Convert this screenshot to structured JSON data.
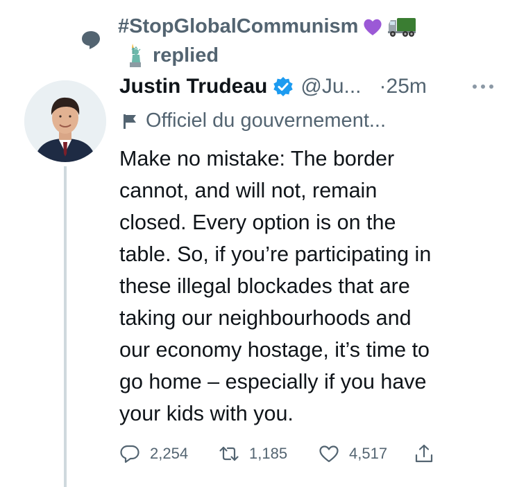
{
  "context": {
    "user_display": "#StopGlobalCommunism",
    "action_text": "replied",
    "icons": [
      "reply-bubble-icon",
      "purple-heart-emoji",
      "truck-emoji",
      "statue-of-liberty-emoji"
    ]
  },
  "tweet": {
    "author_name": "Justin Trudeau",
    "verified": true,
    "handle": "@Ju...",
    "separator": "·",
    "time": "25m",
    "account_label": "Officiel du gouvernement...",
    "text": "Make no mistake: The border\ncannot, and will not, remain\nclosed. Every option is on the\ntable. So, if you’re participating in\nthese illegal blockades that are\ntaking our neighbourhoods and\nour economy hostage, it’s time to\ngo home – especially if you have\nyour kids with you."
  },
  "actions": {
    "replies": "2,254",
    "retweets": "1,185",
    "likes": "4,517"
  },
  "colors": {
    "secondary_text": "#536471",
    "primary_text": "#0f1419",
    "verified_blue": "#1d9bf0",
    "thread_line": "#cfd9de"
  }
}
